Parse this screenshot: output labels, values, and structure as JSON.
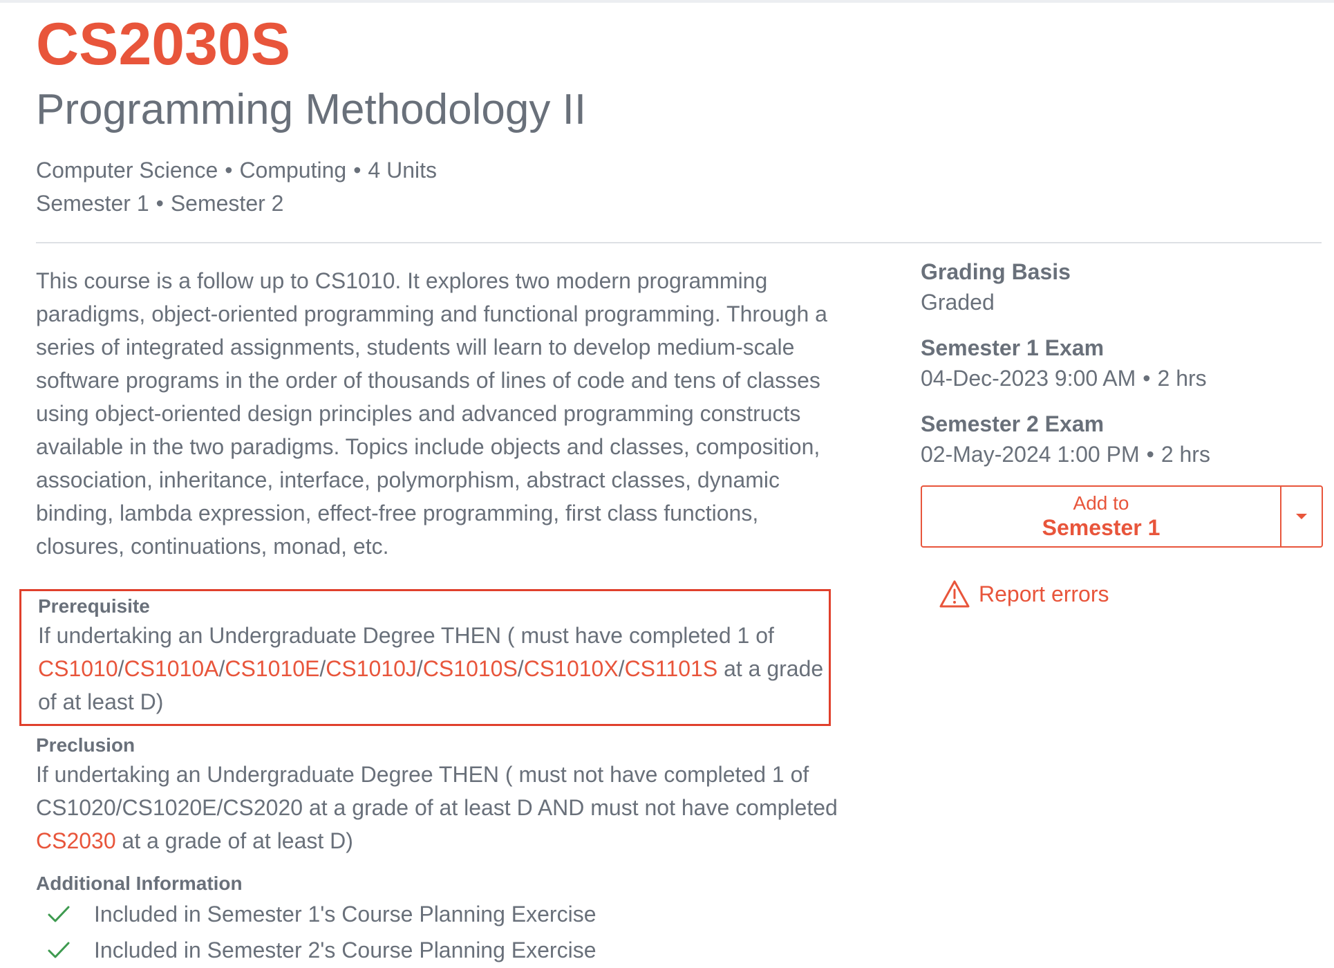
{
  "module": {
    "code": "CS2030S",
    "title": "Programming Methodology II",
    "meta_line1": [
      "Computer Science",
      "Computing",
      "4 Units"
    ],
    "meta_line2": [
      "Semester 1",
      "Semester 2"
    ],
    "description": "This course is a follow up to CS1010. It explores two modern programming paradigms, object-oriented programming and functional programming. Through a series of integrated assignments, students will learn to develop medium-scale software programs in the order of thousands of lines of code and tens of classes using object-oriented design principles and advanced programming constructs available in the two paradigms. Topics include objects and classes, composition, association, inheritance, interface, polymorphism, abstract classes, dynamic binding, lambda expression, effect-free programming, first class functions, closures, continuations, monad, etc."
  },
  "prerequisite": {
    "label": "Prerequisite",
    "text_before": "If undertaking an Undergraduate Degree THEN ( must have completed 1 of ",
    "links": [
      "CS1010",
      "CS1010A",
      "CS1010E",
      "CS1010J",
      "CS1010S",
      "CS1010X",
      "CS1101S"
    ],
    "separator": "/",
    "text_after": " at a grade of at least D)"
  },
  "preclusion": {
    "label": "Preclusion",
    "text_before": "If undertaking an Undergraduate Degree THEN ( must not have completed 1 of CS1020/CS1020E/CS2020 at a grade of at least D AND must not have completed ",
    "link": "CS2030",
    "text_after": " at a grade of at least D)"
  },
  "additional_info": {
    "label": "Additional Information",
    "items": [
      "Included in Semester 1's Course Planning Exercise",
      "Included in Semester 2's Course Planning Exercise"
    ]
  },
  "sidebar": {
    "grading_label": "Grading Basis",
    "grading_value": "Graded",
    "exam1_label": "Semester 1 Exam",
    "exam1_value": "04-Dec-2023 9:00 AM",
    "exam1_duration": "2 hrs",
    "exam2_label": "Semester 2 Exam",
    "exam2_value": "02-May-2024 1:00 PM",
    "exam2_duration": "2 hrs",
    "add_to_label": "Add to",
    "add_semester": "Semester 1",
    "report_label": "Report errors"
  },
  "colors": {
    "accent": "#e8553b",
    "text": "#69707a",
    "check": "#3d9a4f",
    "highlight_box": "#e0402c"
  }
}
